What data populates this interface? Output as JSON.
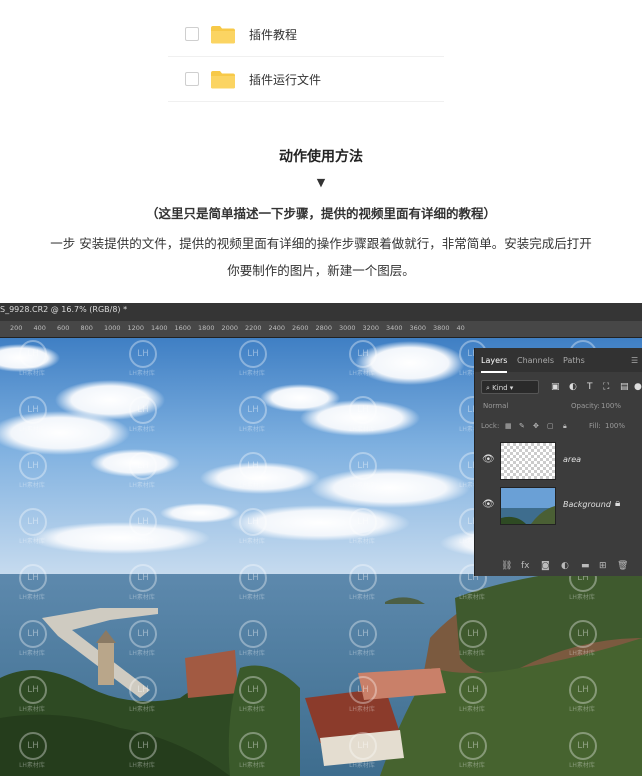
{
  "files": [
    {
      "name": "插件教程"
    },
    {
      "name": "插件运行文件"
    }
  ],
  "section": {
    "title": "动作使用方法",
    "arrow": "▼",
    "note": "（这里只是简单描述一下步骤，提供的视频里面有详细的教程）",
    "para_line1": "一步 安装提供的文件，提供的视频里面有详细的操作步骤跟着做就行，非常简单。安装完成后打开",
    "para_line2": "你要制作的图片，新建一个图层。"
  },
  "photoshop": {
    "doc_tab": "S_9928.CR2 @ 16.7% (RGB/8) *",
    "ruler_numbers": [
      "200",
      "400",
      "600",
      "800",
      "1000",
      "1200",
      "1400",
      "1600",
      "1800",
      "2000",
      "2200",
      "2400",
      "2600",
      "2800",
      "3000",
      "3200",
      "3400",
      "3600",
      "3800",
      "40"
    ],
    "watermark_text": "LH素材库",
    "watermark_letters": "LH",
    "layers_panel": {
      "tabs": [
        "Layers",
        "Channels",
        "Paths"
      ],
      "kind_label": "Kind",
      "blend_mode": "Normal",
      "opacity_label": "Opacity:",
      "opacity_value": "100%",
      "lock_label": "Lock:",
      "fill_label": "Fill:",
      "fill_value": "100%",
      "layers": [
        {
          "name": "area",
          "visible": true,
          "locked": false
        },
        {
          "name": "Background",
          "visible": true,
          "locked": true
        }
      ],
      "bottom_icons": [
        "link-icon",
        "fx-icon",
        "mask-icon",
        "adjustment-icon",
        "group-icon",
        "new-layer-icon",
        "trash-icon"
      ]
    }
  },
  "colors": {
    "folder": "#f7c948",
    "ps_bg": "#2b2b2b",
    "panel_bg": "#3c3c3c"
  }
}
